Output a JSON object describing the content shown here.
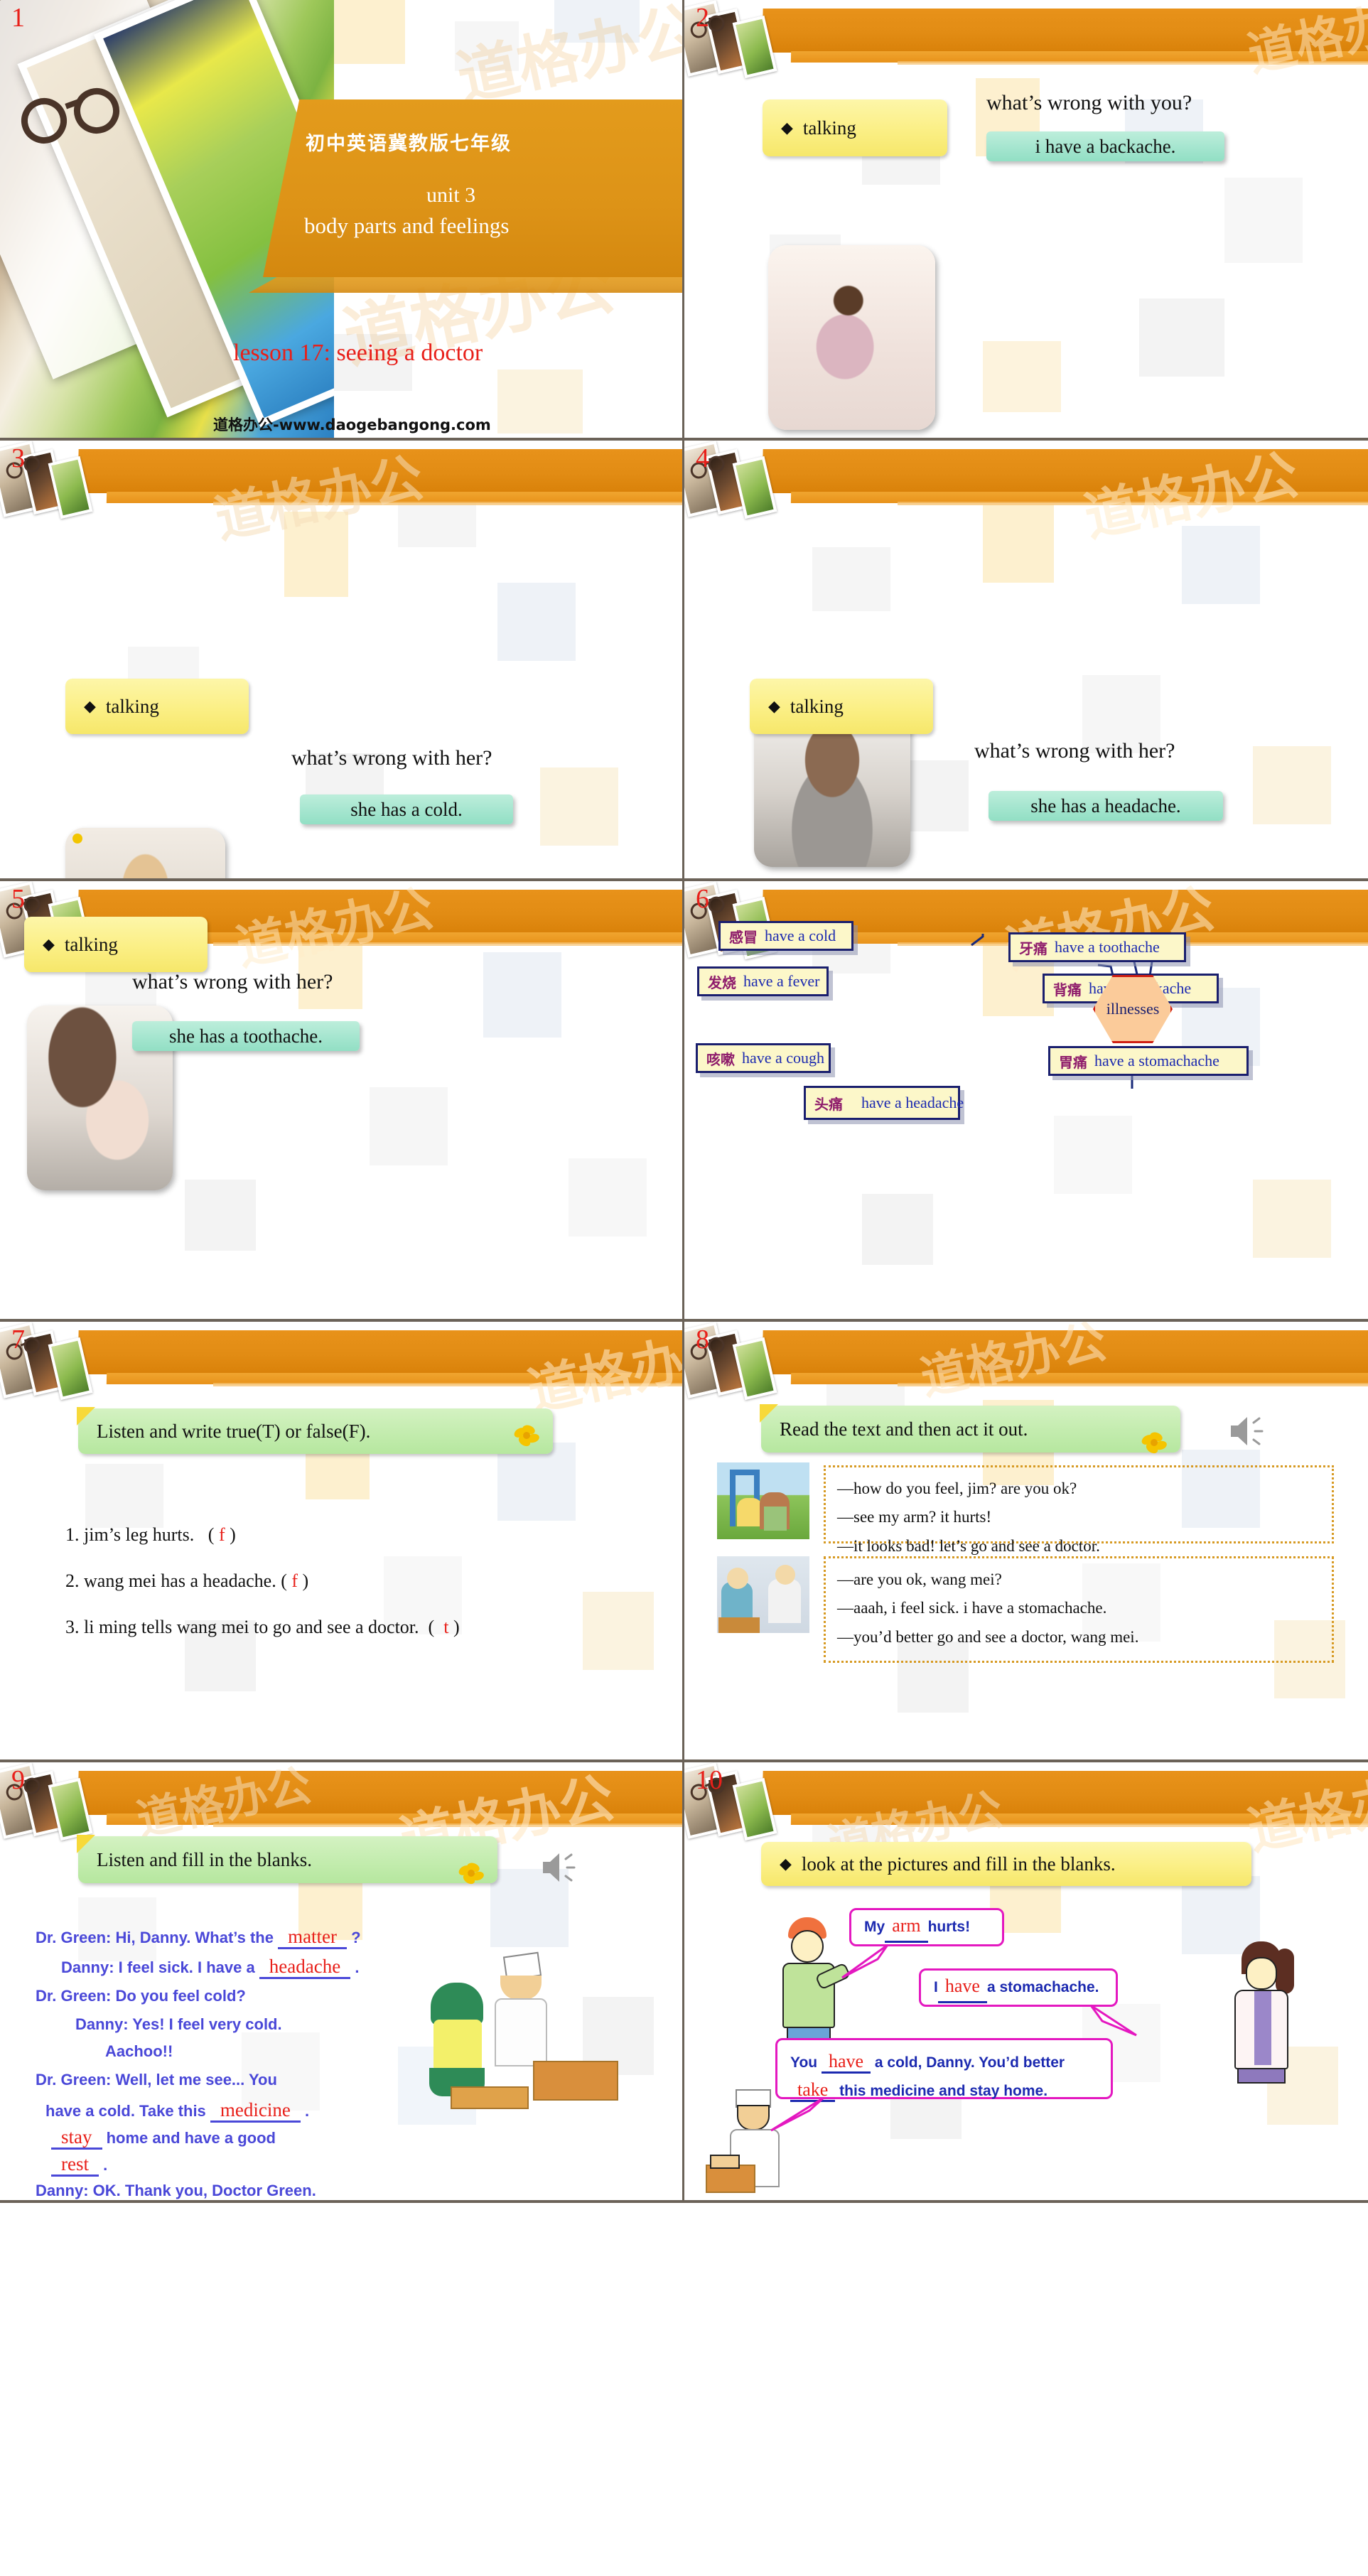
{
  "deck": {
    "watermark": "道格办公",
    "site_url": "道格办公-www.daogebangong.com"
  },
  "slides": [
    {
      "number": "1",
      "title_cn": "初中英语冀教版七年级",
      "unit": "unit 3",
      "unit_sub": "body parts and feelings",
      "lesson": "lesson 17: seeing a doctor",
      "footer_url": "道格办公-www.daogebangong.com"
    },
    {
      "number": "2",
      "tag": "talking",
      "question": "what’s wrong with you?",
      "answer": "i have a backache."
    },
    {
      "number": "3",
      "tag": "talking",
      "question": "what’s wrong with her?",
      "answer": "she has a cold."
    },
    {
      "number": "4",
      "tag": "talking",
      "question": "what’s wrong with her?",
      "answer": "she has a headache."
    },
    {
      "number": "5",
      "tag": "talking",
      "question": "what’s wrong with her?",
      "answer": "she has a toothache."
    },
    {
      "number": "6",
      "center": "illnesses",
      "nodes": [
        {
          "cn": "感冒",
          "en": "have a cold"
        },
        {
          "cn": "牙痛",
          "en": "have a toothache"
        },
        {
          "cn": "发烧",
          "en": "have a fever"
        },
        {
          "cn": "背痛",
          "en": "have a backache"
        },
        {
          "cn": "咳嗽",
          "en": "have a cough"
        },
        {
          "cn": "胃痛",
          "en": "have a stomachache"
        },
        {
          "cn": "头痛",
          "en": "have a headache"
        }
      ]
    },
    {
      "number": "7",
      "tag": "Listen and write true(T) or false(F).",
      "items": [
        {
          "text": "1. jim’s leg hurts.",
          "answer": "f"
        },
        {
          "text": "2. wang mei has a headache.",
          "answer": "f"
        },
        {
          "text": "3. li ming tells wang mei to go and see a doctor.",
          "answer": "t"
        }
      ]
    },
    {
      "number": "8",
      "tag": "Read the text and then act it out.",
      "dialog1": [
        "—how do you feel, jim? are you ok?",
        "—see my arm? it hurts!",
        "—it looks bad! let’s go and see a doctor."
      ],
      "dialog2": [
        "—are you ok, wang mei?",
        "—aaah, i feel sick. i have a stomachache.",
        "—you’d better go and see a doctor, wang mei."
      ]
    },
    {
      "number": "9",
      "tag": "Listen and fill in the blanks.",
      "lines": [
        {
          "pre": "Dr. Green: Hi, Danny. What’s the ",
          "blank": "matter",
          "post": " ?"
        },
        {
          "pre": "Danny: I feel sick. I have a ",
          "blank": "headache",
          "post": " ."
        },
        {
          "pre": "Dr. Green: Do you feel cold?",
          "blank": "",
          "post": ""
        },
        {
          "pre": "Danny: Yes! I feel very cold.",
          "blank": "",
          "post": ""
        },
        {
          "pre": "Aachoo!!",
          "blank": "",
          "post": ""
        },
        {
          "pre": "Dr. Green: Well, let me see... You",
          "blank": "",
          "post": ""
        },
        {
          "pre": "have a cold. Take this ",
          "blank": "medicine",
          "post": " ."
        },
        {
          "pre": "",
          "blank": "stay",
          "post": " home and have a good"
        },
        {
          "pre": "",
          "blank": "rest",
          "post": " ."
        },
        {
          "pre": "Danny: OK. Thank you, Doctor Green.",
          "blank": "",
          "post": ""
        }
      ]
    },
    {
      "number": "10",
      "tag": "look at the pictures and fill in the blanks.",
      "bubbles": [
        {
          "pre": "My ",
          "blank": "arm",
          "post": " hurts!"
        },
        {
          "pre": "I ",
          "blank": "have",
          "post": " a stomachache."
        },
        {
          "pre": "You ",
          "blank": "have",
          "post": " a cold, Danny. You’d better",
          "blank2": "take",
          "post2": " this medicine and stay home."
        }
      ]
    }
  ]
}
